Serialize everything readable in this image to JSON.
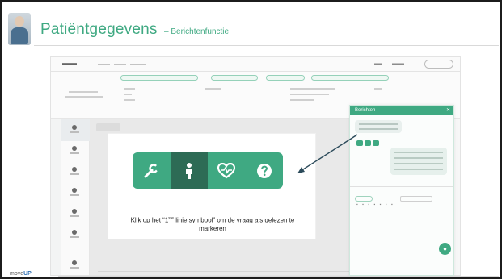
{
  "slide": {
    "title": "Patiëntgegevens",
    "subtitle": "– Berichtenfunctie",
    "brand_prefix": "move",
    "brand_suffix": "UP"
  },
  "callout": {
    "text_line1_prefix": "Klik op het “1",
    "text_line1_sup": "ste",
    "text_line1_suffix": " linie symbool”  om de vraag als gelezen te",
    "text_line2": "markeren",
    "toolbar_buttons": [
      {
        "name": "wrench",
        "active": false
      },
      {
        "name": "person",
        "active": true
      },
      {
        "name": "heart-pulse",
        "active": false
      },
      {
        "name": "question",
        "active": false
      }
    ]
  },
  "message_panel": {
    "header": "Berichten",
    "close": "✕"
  },
  "colors": {
    "accent": "#3fa982",
    "accent_dark": "#2d6b55",
    "arrow": "#2b4a5a"
  }
}
